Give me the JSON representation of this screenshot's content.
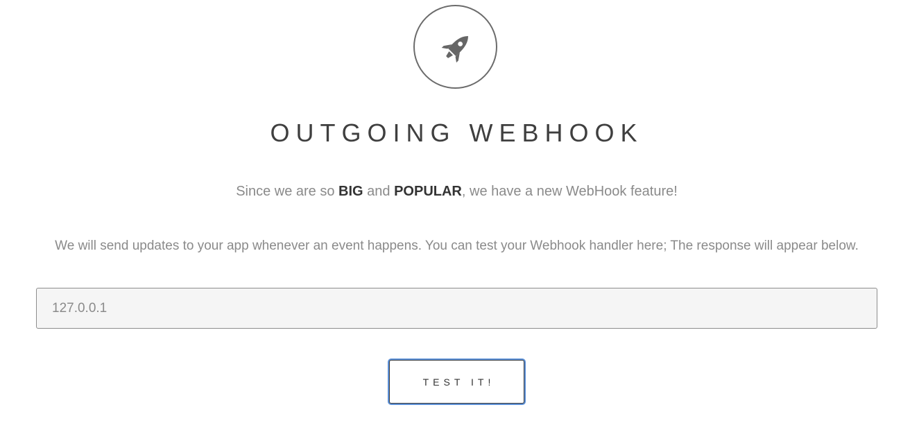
{
  "header": {
    "icon": "rocket-icon",
    "title": "OUTGOING WEBHOOK"
  },
  "intro": {
    "prefix": "Since we are so ",
    "big": "BIG",
    "and": " and ",
    "popular": "POPULAR",
    "suffix": ", we have a new WebHook feature!"
  },
  "description": "We will send updates to your app whenever an event happens. You can test your Webhook handler here; The response will appear below.",
  "form": {
    "url_value": "127.0.0.1",
    "button_label": "TEST IT!"
  },
  "colors": {
    "icon": "#666666",
    "title": "#3f3f3f",
    "button_focus_ring": "#5b8fd6"
  }
}
